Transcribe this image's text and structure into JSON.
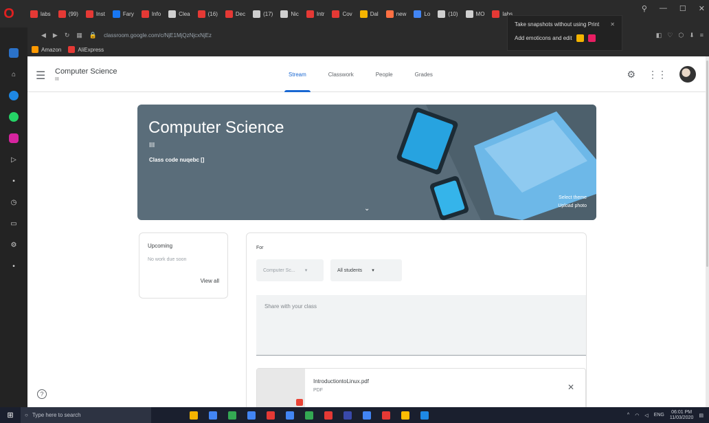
{
  "browser": {
    "tabs": [
      {
        "label": "labs",
        "color": "#e53935"
      },
      {
        "label": "(99)",
        "color": "#e53935"
      },
      {
        "label": "Inst",
        "color": "#e53935"
      },
      {
        "label": "Fary",
        "color": "#1877f2"
      },
      {
        "label": "Info",
        "color": "#e53935"
      },
      {
        "label": "Clea",
        "color": "#cfcfcf"
      },
      {
        "label": "(16)",
        "color": "#e53935"
      },
      {
        "label": "Dec",
        "color": "#e53935"
      },
      {
        "label": "(17)",
        "color": "#cfcfcf"
      },
      {
        "label": "Nic",
        "color": "#cfcfcf"
      },
      {
        "label": "Intr",
        "color": "#e53935"
      },
      {
        "label": "Cov",
        "color": "#e53935"
      },
      {
        "label": "Dal",
        "color": "#f4b400"
      },
      {
        "label": "new",
        "color": "#ff7043"
      },
      {
        "label": "Lo",
        "color": "#4285f4"
      },
      {
        "label": "(10)",
        "color": "#cfcfcf"
      },
      {
        "label": "MO",
        "color": "#cfcfcf"
      },
      {
        "label": "labs",
        "color": "#e53935"
      }
    ],
    "url": "classroom.google.com/c/NjE1MjQzNjcxNjEz",
    "bookmarks": [
      {
        "label": "Amazon",
        "color": "#ff9900"
      },
      {
        "label": "AliExpress",
        "color": "#e53935"
      }
    ],
    "tooltip": {
      "line1": "Take snapshots without using Print",
      "line2": "Add emoticons and edit"
    }
  },
  "classroom": {
    "header": {
      "class_name": "Computer Science",
      "class_sub": "III",
      "tabs": [
        "Stream",
        "Classwork",
        "People",
        "Grades"
      ],
      "active_tab": 0
    },
    "banner": {
      "title": "Computer Science",
      "section": "III",
      "class_code": "Class code  nuqebc []",
      "select_theme": "Select theme",
      "upload_photo": "Upload photo"
    },
    "upcoming": {
      "heading": "Upcoming",
      "subtext": "No work due soon",
      "view_all": "View all"
    },
    "share": {
      "for_label": "For",
      "class_select": "Computer Sc...",
      "students_select": "All students",
      "placeholder": "Share with your class",
      "attachment_name": "IntroductiontoLinux.pdf",
      "attachment_type": "PDF"
    }
  },
  "taskbar": {
    "search_placeholder": "Type here to search",
    "time": "06:01 PM",
    "date": "11/03/2020",
    "lang": "ENG",
    "icons": [
      "#f4b400",
      "#4285f4",
      "#34a853",
      "#4285f4",
      "#e53935",
      "#4285f4",
      "#34a853",
      "#e53935",
      "#3949ab",
      "#4285f4",
      "#e53935",
      "#fbbc04",
      "#1e88e5"
    ]
  }
}
